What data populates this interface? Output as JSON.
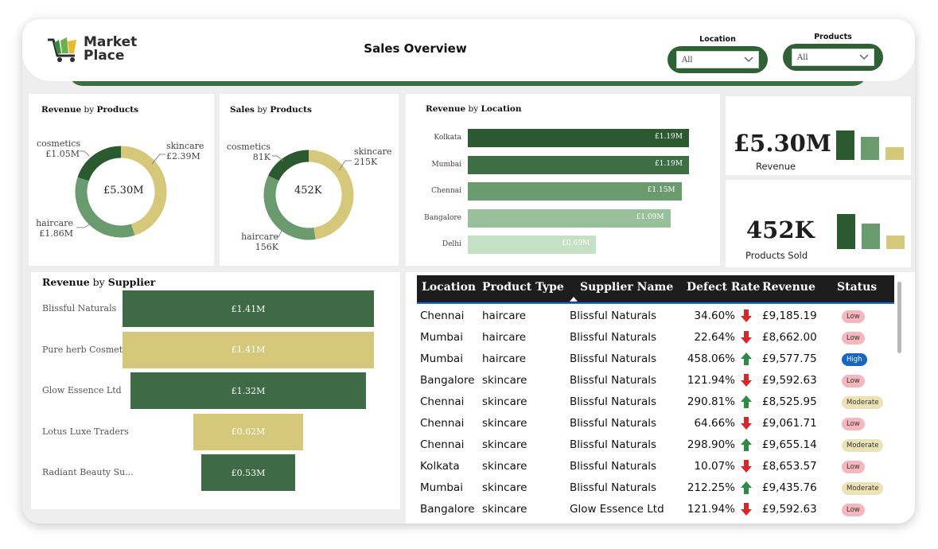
{
  "header": {
    "logo_line1": "Market",
    "logo_line2": "Place",
    "title": "Sales Overview",
    "filters": [
      {
        "label": "Location",
        "value": "All"
      },
      {
        "label": "Products",
        "value": "All"
      }
    ]
  },
  "revenue_by_products": {
    "title_bold1": "Revenue",
    "title_mid": "by",
    "title_bold2": "Products",
    "center": "£5.30M",
    "slices": [
      {
        "name": "skincare",
        "value": 2.39,
        "label": "£2.39M",
        "color": "#d6c87a"
      },
      {
        "name": "haircare",
        "value": 1.86,
        "label": "£1.86M",
        "color": "#6a9b6e"
      },
      {
        "name": "cosmetics",
        "value": 1.05,
        "label": "£1.05M",
        "color": "#2b5a30"
      }
    ]
  },
  "sales_by_products": {
    "title_bold1": "Sales",
    "title_mid": "by",
    "title_bold2": "Products",
    "center": "452K",
    "slices": [
      {
        "name": "skincare",
        "value": 215,
        "label": "215K",
        "color": "#d6c87a"
      },
      {
        "name": "haircare",
        "value": 156,
        "label": "156K",
        "color": "#6a9b6e"
      },
      {
        "name": "cosmetics",
        "value": 81,
        "label": "81K",
        "color": "#2b5a30"
      }
    ]
  },
  "revenue_by_location": {
    "title_bold1": "Revenue",
    "title_mid": "by",
    "title_bold2": "Location",
    "max": 1.19,
    "bars": [
      {
        "name": "Kolkata",
        "value": 1.19,
        "label": "£1.19M",
        "color": "#2b5a30"
      },
      {
        "name": "Mumbai",
        "value": 1.19,
        "label": "£1.19M",
        "color": "#3e6f44"
      },
      {
        "name": "Chennai",
        "value": 1.15,
        "label": "£1.15M",
        "color": "#6a9b6e"
      },
      {
        "name": "Bangalore",
        "value": 1.09,
        "label": "£1.09M",
        "color": "#98c19b"
      },
      {
        "name": "Delhi",
        "value": 0.69,
        "label": "£0.69M",
        "color": "#c4e1c5"
      }
    ]
  },
  "kpi_revenue": {
    "value": "£5.30M",
    "label": "Revenue",
    "bars": [
      {
        "level": 1.0,
        "color": "#2b5a30"
      },
      {
        "level": 0.78,
        "color": "#6a9b6e"
      },
      {
        "level": 0.44,
        "color": "#d6c87a"
      }
    ]
  },
  "kpi_products": {
    "value": "452K",
    "label": "Products Sold",
    "bars": [
      {
        "level": 1.0,
        "color": "#2b5a30"
      },
      {
        "level": 0.73,
        "color": "#6a9b6e"
      },
      {
        "level": 0.38,
        "color": "#d6c87a"
      }
    ]
  },
  "revenue_by_supplier": {
    "title_bold1": "Revenue",
    "title_mid": "by",
    "title_bold2": "Supplier",
    "max": 1.41,
    "bars": [
      {
        "name": "Blissful Naturals",
        "value": 1.41,
        "label": "£1.41M",
        "color": "#3e6b45"
      },
      {
        "name": "Pure herb Cosmetics",
        "value": 1.41,
        "label": "£1.41M",
        "color": "#d6c87a"
      },
      {
        "name": "Glow Essence Ltd",
        "value": 1.32,
        "label": "£1.32M",
        "color": "#3e6b45"
      },
      {
        "name": "Lotus Luxe Traders",
        "value": 0.62,
        "label": "£0.62M",
        "color": "#d6c87a"
      },
      {
        "name": "Radiant Beauty Su...",
        "value": 0.53,
        "label": "£0.53M",
        "color": "#3e6b45"
      }
    ]
  },
  "table": {
    "columns": [
      "Location",
      "Product Type",
      "Supplier Name",
      "Defect Rate",
      "Revenue",
      "Status"
    ],
    "rows": [
      {
        "location": "Chennai",
        "product": "haircare",
        "supplier": "Blissful Naturals",
        "defect": "34.60%",
        "trend": "down",
        "revenue": "£9,185.19",
        "status": "Low"
      },
      {
        "location": "Mumbai",
        "product": "haircare",
        "supplier": "Blissful Naturals",
        "defect": "22.64%",
        "trend": "down",
        "revenue": "£8,662.00",
        "status": "Low"
      },
      {
        "location": "Mumbai",
        "product": "haircare",
        "supplier": "Blissful Naturals",
        "defect": "458.06%",
        "trend": "up",
        "revenue": "£9,577.75",
        "status": "High"
      },
      {
        "location": "Bangalore",
        "product": "skincare",
        "supplier": "Blissful Naturals",
        "defect": "121.94%",
        "trend": "down",
        "revenue": "£9,592.63",
        "status": "Low"
      },
      {
        "location": "Chennai",
        "product": "skincare",
        "supplier": "Blissful Naturals",
        "defect": "290.81%",
        "trend": "up",
        "revenue": "£8,525.95",
        "status": "Moderate"
      },
      {
        "location": "Chennai",
        "product": "skincare",
        "supplier": "Blissful Naturals",
        "defect": "64.66%",
        "trend": "down",
        "revenue": "£9,061.71",
        "status": "Low"
      },
      {
        "location": "Chennai",
        "product": "skincare",
        "supplier": "Blissful Naturals",
        "defect": "298.90%",
        "trend": "up",
        "revenue": "£9,655.14",
        "status": "Moderate"
      },
      {
        "location": "Kolkata",
        "product": "skincare",
        "supplier": "Blissful Naturals",
        "defect": "10.07%",
        "trend": "down",
        "revenue": "£8,653.57",
        "status": "Low"
      },
      {
        "location": "Mumbai",
        "product": "skincare",
        "supplier": "Blissful Naturals",
        "defect": "212.25%",
        "trend": "up",
        "revenue": "£9,435.76",
        "status": "Moderate"
      },
      {
        "location": "Bangalore",
        "product": "skincare",
        "supplier": "Glow Essence Ltd",
        "defect": "121.94%",
        "trend": "down",
        "revenue": "£9,592.63",
        "status": "Low"
      }
    ]
  },
  "chart_data": [
    {
      "type": "pie",
      "title": "Revenue by Products",
      "categories": [
        "skincare",
        "haircare",
        "cosmetics"
      ],
      "values": [
        2.39,
        1.86,
        1.05
      ]
    },
    {
      "type": "pie",
      "title": "Sales by Products",
      "categories": [
        "skincare",
        "haircare",
        "cosmetics"
      ],
      "values": [
        215,
        156,
        81
      ]
    },
    {
      "type": "bar",
      "title": "Revenue by Location",
      "categories": [
        "Kolkata",
        "Mumbai",
        "Chennai",
        "Bangalore",
        "Delhi"
      ],
      "values": [
        1.19,
        1.19,
        1.15,
        1.09,
        0.69
      ]
    },
    {
      "type": "bar",
      "title": "Revenue by Supplier",
      "categories": [
        "Blissful Naturals",
        "Pure herb Cosmetics",
        "Glow Essence Ltd",
        "Lotus Luxe Traders",
        "Radiant Beauty Su..."
      ],
      "values": [
        1.41,
        1.41,
        1.32,
        0.62,
        0.53
      ]
    }
  ]
}
